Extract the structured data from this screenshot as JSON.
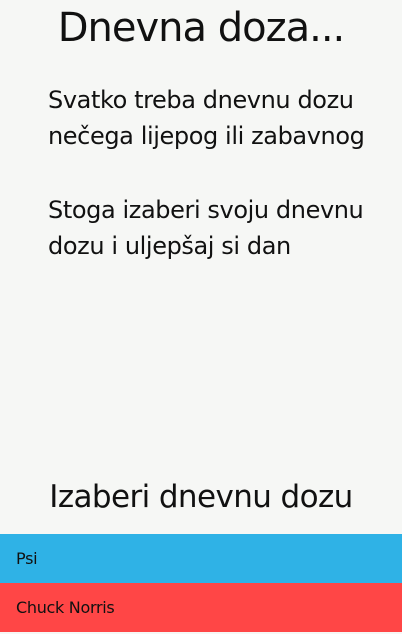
{
  "header": {
    "title": "Dnevna doza..."
  },
  "intro": {
    "line1": "Svatko treba dnevnu dozu nečega lijepog ili zabavnog",
    "line2": "Stoga izaberi svoju dnevnu dozu i uljepšaj si dan"
  },
  "chooser": {
    "heading": "Izaberi dnevnu dozu",
    "options": [
      {
        "label": "Psi",
        "color": "#2fb2e6"
      },
      {
        "label": "Chuck Norris",
        "color": "#ff4646"
      }
    ]
  }
}
